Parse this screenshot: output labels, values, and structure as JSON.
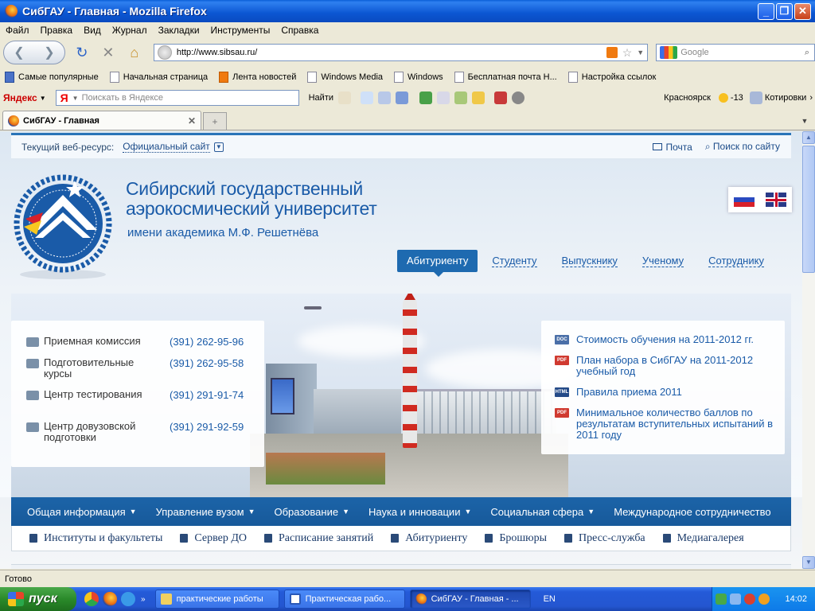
{
  "window": {
    "title": "СибГАУ - Главная - Mozilla Firefox"
  },
  "menubar": [
    "Файл",
    "Правка",
    "Вид",
    "Журнал",
    "Закладки",
    "Инструменты",
    "Справка"
  ],
  "navbar": {
    "url": "http://www.sibsau.ru/",
    "search_placeholder": "Google"
  },
  "bookmarks": [
    {
      "label": "Самые популярные",
      "icon": "bookmark-folder-icon"
    },
    {
      "label": "Начальная страница",
      "icon": "page-icon"
    },
    {
      "label": "Лента новостей",
      "icon": "rss-icon"
    },
    {
      "label": "Windows Media",
      "icon": "page-icon"
    },
    {
      "label": "Windows",
      "icon": "page-icon"
    },
    {
      "label": "Бесплатная почта H...",
      "icon": "page-icon"
    },
    {
      "label": "Настройка ссылок",
      "icon": "page-icon"
    }
  ],
  "yandex_bar": {
    "logo": "Яндекс",
    "search_placeholder": "Поискать в Яндексе",
    "find_label": "Найти",
    "city": "Красноярск",
    "weather": "-13",
    "quotes": "Котировки"
  },
  "tab": {
    "title": "СибГАУ - Главная"
  },
  "site": {
    "top_label": "Текущий веб-ресурс:",
    "top_select": "Официальный сайт",
    "mail": "Почта",
    "search": "Поиск по сайту",
    "name_line1": "Сибирский государственный",
    "name_line2": "аэрокосмический университет",
    "name_sub": "имени академика М.Ф. Решетнёва",
    "roles": [
      "Абитуриенту",
      "Студенту",
      "Выпускнику",
      "Ученому",
      "Сотруднику"
    ],
    "contacts": [
      {
        "name": "Приемная комиссия",
        "phone": "(391) 262-95-96"
      },
      {
        "name": "Подготовительные курсы",
        "phone": "(391) 262-95-58"
      },
      {
        "name": "Центр тестирования",
        "phone": "(391) 291-91-74"
      },
      {
        "name": "Центр довузовской подготовки",
        "phone": "(391) 291-92-59"
      }
    ],
    "docs": [
      {
        "type": "DOC",
        "text": "Стоимость обучения на 2011-2012 гг."
      },
      {
        "type": "PDF",
        "text": "План набора в СибГАУ на 2011-2012 учебный год"
      },
      {
        "type": "HTML",
        "text": "Правила приема 2011"
      },
      {
        "type": "PDF",
        "text": "Минимальное количество баллов по результатам вступительных испытаний в 2011 году"
      }
    ],
    "main_menu": [
      "Общая информация",
      "Управление вузом",
      "Образование",
      "Наука и инновации",
      "Социальная сфера",
      "Международное сотрудничество"
    ],
    "sub_menu": [
      "Институты и факультеты",
      "Сервер ДО",
      "Расписание занятий",
      "Абитуриенту",
      "Брошюры",
      "Пресс-служба",
      "Медиагалерея"
    ]
  },
  "statusbar": {
    "text": "Готово"
  },
  "taskbar": {
    "start": "пуск",
    "tasks": [
      "практические работы",
      "Практическая рабо...",
      "СибГАУ - Главная - ..."
    ],
    "lang": "EN",
    "clock": "14:02"
  },
  "colors": {
    "brand_blue": "#1e6ab0",
    "link_blue": "#1a5ba8"
  }
}
